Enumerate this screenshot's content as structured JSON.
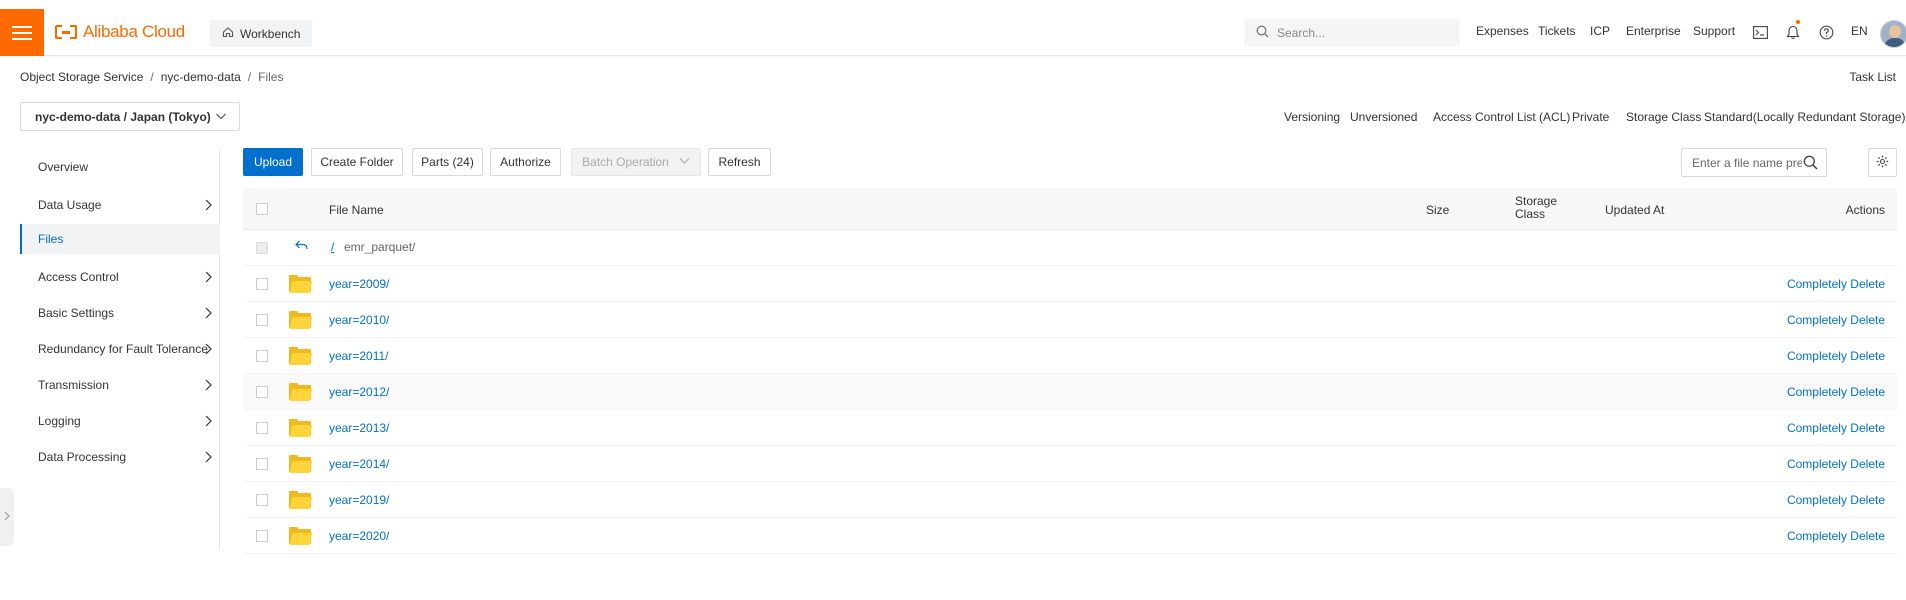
{
  "header": {
    "brand": "Alibaba Cloud",
    "workbench": "Workbench",
    "search_placeholder": "Search...",
    "nav": [
      "Expenses",
      "Tickets",
      "ICP",
      "Enterprise",
      "Support"
    ],
    "lang": "EN",
    "icons": [
      "terminal-icon",
      "bell-icon",
      "help-icon"
    ],
    "accent": "#ff6a00"
  },
  "breadcrumb": {
    "items": [
      "Object Storage Service",
      "nyc-demo-data",
      "Files"
    ],
    "separator": "/"
  },
  "task_list": "Task List",
  "bucket": {
    "selected": "nyc-demo-data / Japan (Tokyo)"
  },
  "meta": {
    "versioning_label": "Versioning",
    "versioning_value": "Unversioned",
    "acl_label": "Access Control List (ACL)",
    "acl_value": "Private",
    "storage_label": "Storage Class",
    "storage_value": "Standard(Locally Redundant Storage)"
  },
  "sidebar": {
    "items": [
      {
        "label": "Overview",
        "arrow": false,
        "active": false
      },
      {
        "label": "Data Usage",
        "arrow": true,
        "active": false
      },
      {
        "label": "Files",
        "arrow": false,
        "active": true
      },
      {
        "label": "Access Control",
        "arrow": true,
        "active": false
      },
      {
        "label": "Basic Settings",
        "arrow": true,
        "active": false
      },
      {
        "label": "Redundancy for Fault Tolerance",
        "arrow": true,
        "active": false
      },
      {
        "label": "Transmission",
        "arrow": true,
        "active": false
      },
      {
        "label": "Logging",
        "arrow": true,
        "active": false
      },
      {
        "label": "Data Processing",
        "arrow": true,
        "active": false
      }
    ]
  },
  "toolbar": {
    "upload": "Upload",
    "create_folder": "Create Folder",
    "parts": "Parts (24)",
    "authorize": "Authorize",
    "batch": "Batch Operation",
    "refresh": "Refresh",
    "prefix_placeholder": "Enter a file name prefix"
  },
  "table": {
    "columns": {
      "name": "File Name",
      "size": "Size",
      "storage": "Storage Class",
      "updated": "Updated At",
      "actions": "Actions"
    },
    "parent": {
      "slash": "/",
      "path": "emr_parquet/"
    },
    "rows": [
      {
        "name": "year=2009/",
        "action": "Completely Delete"
      },
      {
        "name": "year=2010/",
        "action": "Completely Delete"
      },
      {
        "name": "year=2011/",
        "action": "Completely Delete"
      },
      {
        "name": "year=2012/",
        "action": "Completely Delete"
      },
      {
        "name": "year=2013/",
        "action": "Completely Delete"
      },
      {
        "name": "year=2014/",
        "action": "Completely Delete"
      },
      {
        "name": "year=2019/",
        "action": "Completely Delete"
      },
      {
        "name": "year=2020/",
        "action": "Completely Delete"
      }
    ],
    "link_color": "#0070cc"
  }
}
